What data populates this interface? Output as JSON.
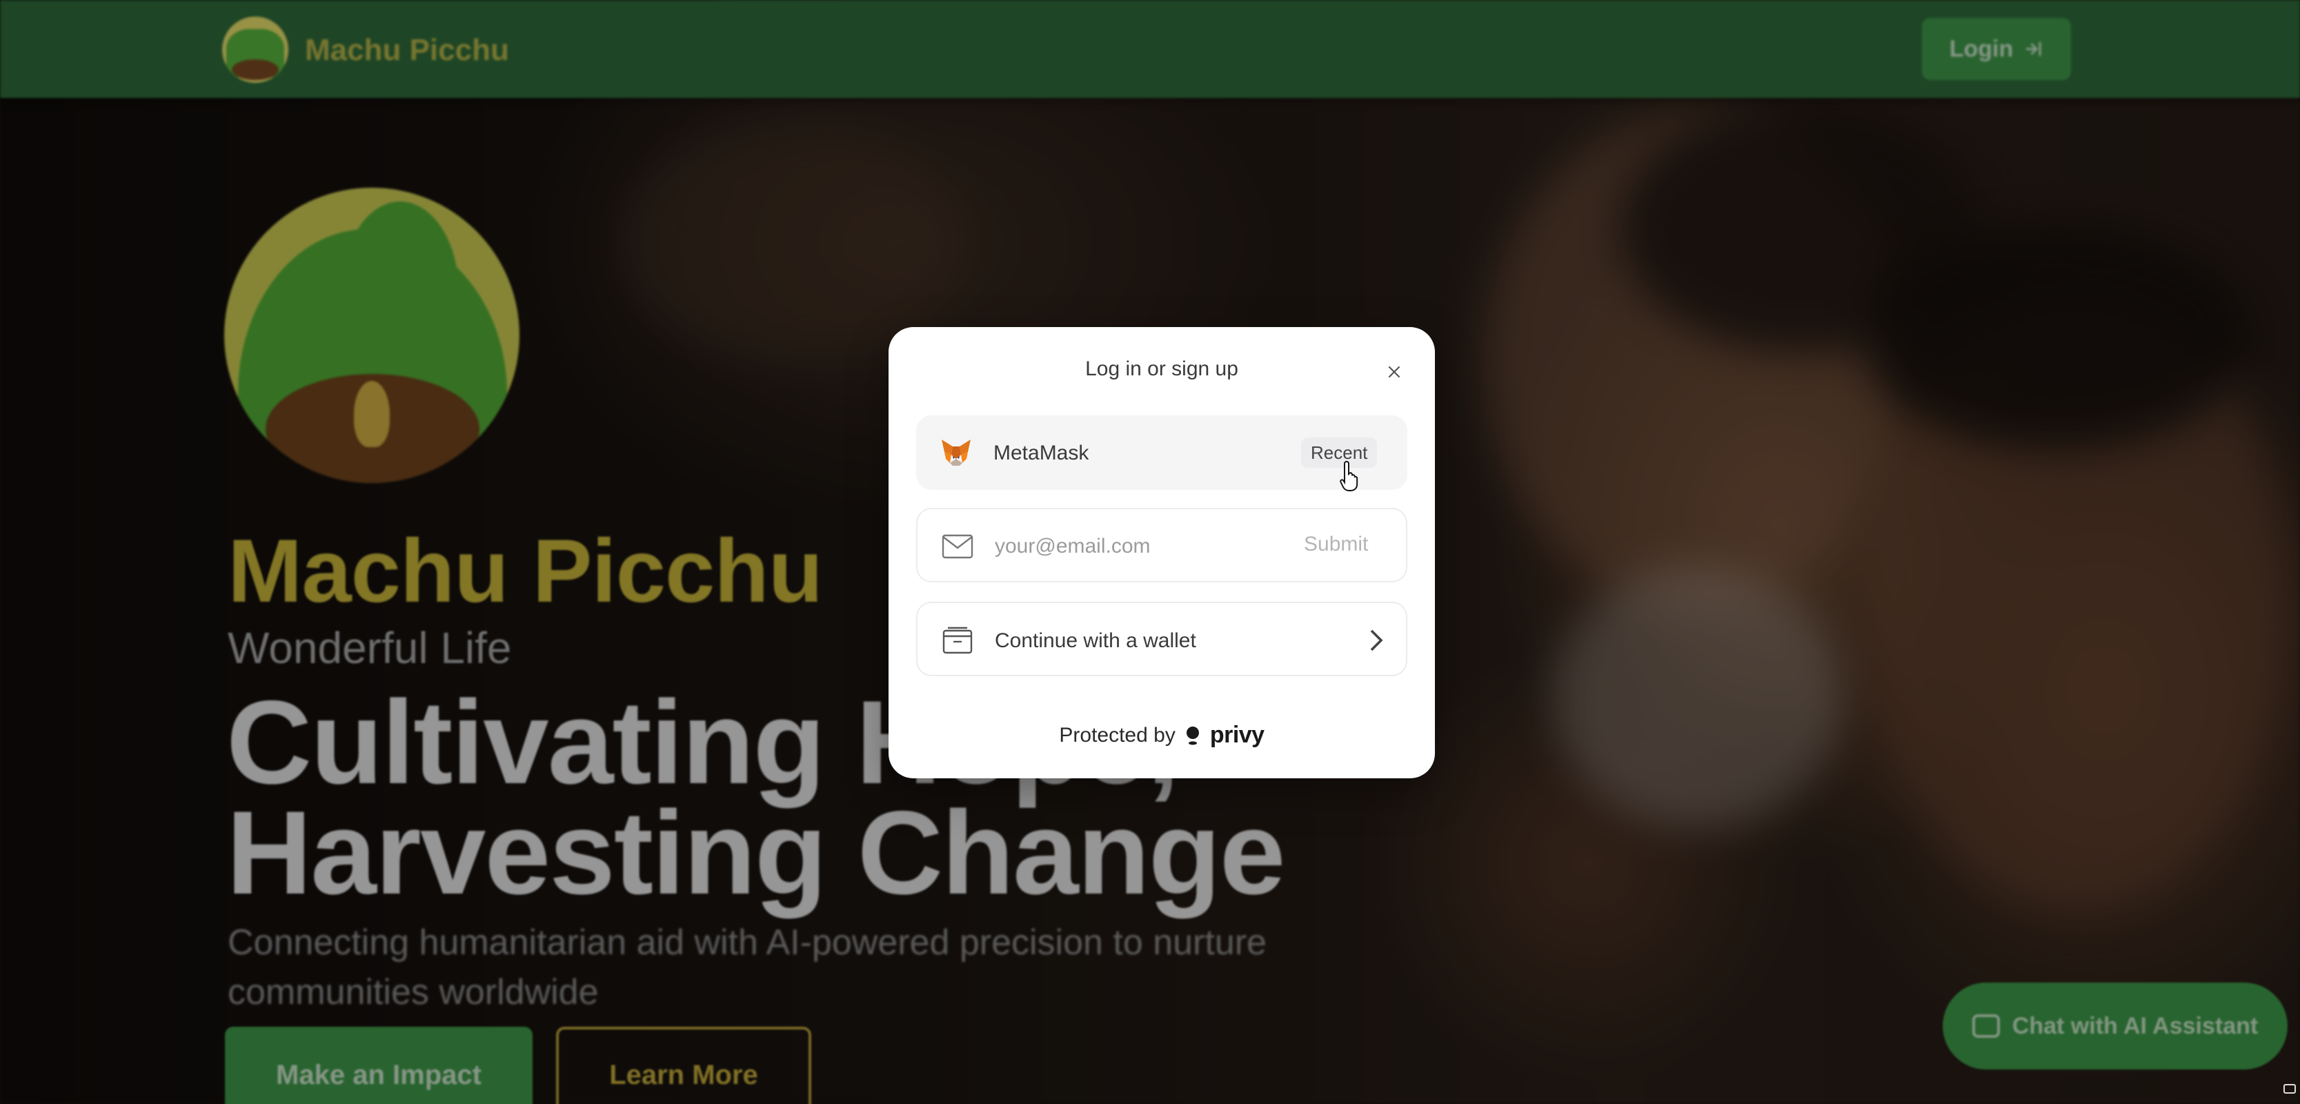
{
  "nav": {
    "brand": "Machu Picchu",
    "login_label": "Login"
  },
  "hero": {
    "title": "Machu Picchu",
    "subtitle": "Wonderful Life",
    "headline_line1": "Cultivating Hope,",
    "headline_line2": "Harvesting Change",
    "description": "Connecting humanitarian aid with AI-powered precision to nurture communities worldwide",
    "primary_button": "Make an Impact",
    "secondary_button": "Learn More"
  },
  "chat": {
    "label": "Chat with AI Assistant"
  },
  "modal": {
    "title": "Log in or sign up",
    "metamask_label": "MetaMask",
    "metamask_badge": "Recent",
    "email_placeholder": "your@email.com",
    "email_value": "",
    "submit_label": "Submit",
    "wallet_label": "Continue with a wallet",
    "protected_prefix": "Protected by",
    "provider": "privy"
  },
  "colors": {
    "nav_green": "#2f6b3a",
    "accent_green": "#3f9a4a",
    "brand_yellow": "#c9b63a",
    "modal_bg": "#ffffff"
  },
  "icons": [
    "metamask-icon",
    "mail-icon",
    "wallet-icon",
    "chevron-right-icon",
    "close-icon",
    "privy-icon",
    "login-arrow-icon",
    "chat-bubble-icon"
  ]
}
